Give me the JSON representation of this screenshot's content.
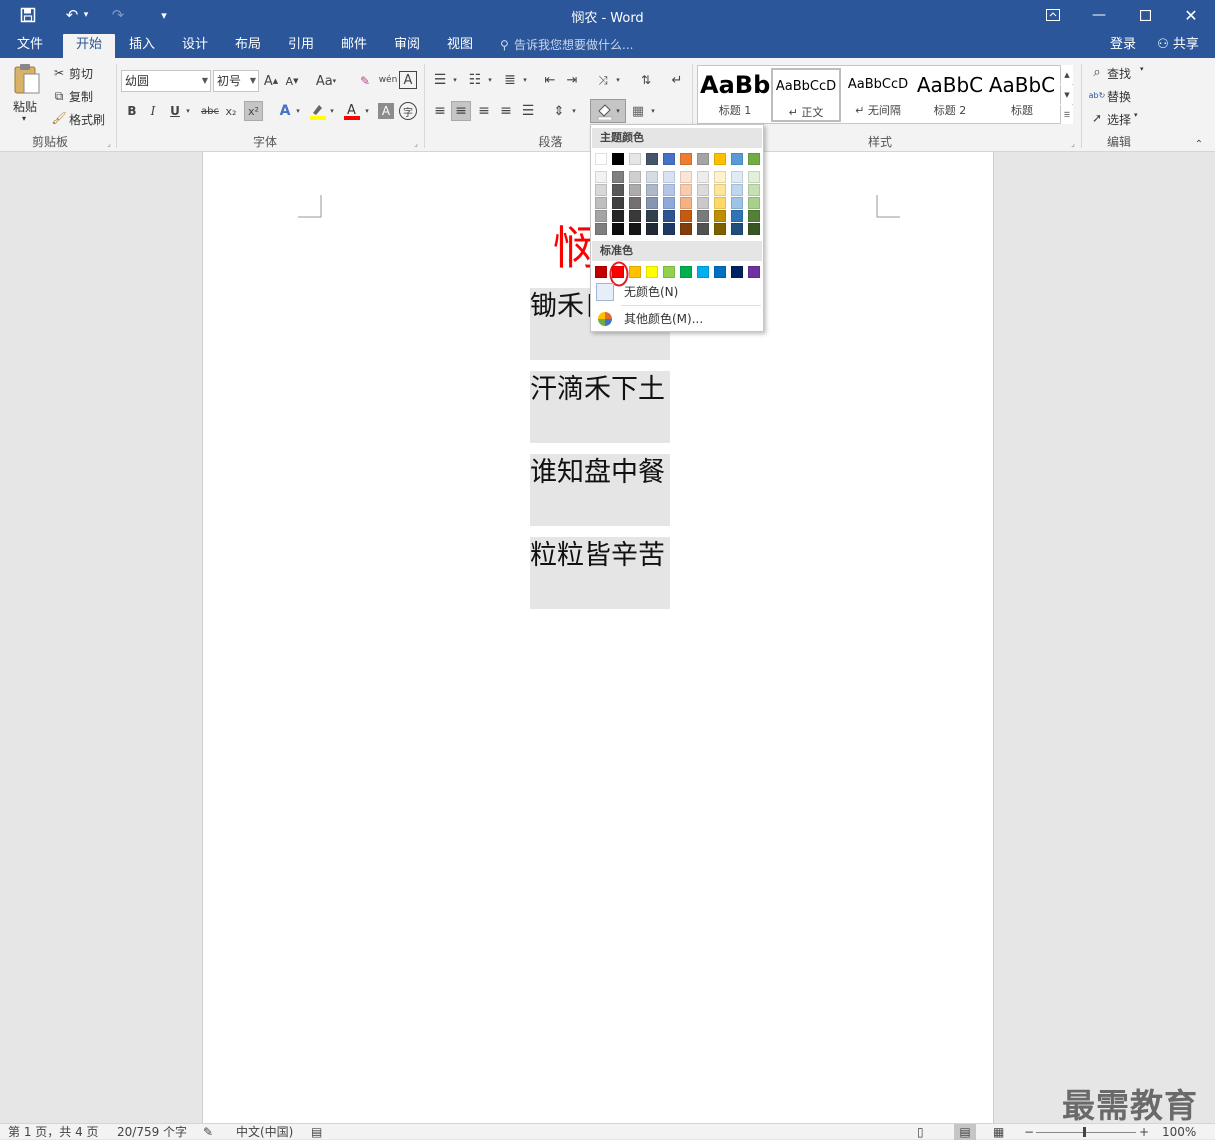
{
  "window": {
    "title": "悯农 - Word"
  },
  "quick_access": {
    "save": "save",
    "undo": "undo",
    "redo": "redo",
    "customize": "customize"
  },
  "window_controls": [
    "restore-ribbon",
    "minimize",
    "maximize",
    "close"
  ],
  "tabs": [
    {
      "label": "文件",
      "active": false
    },
    {
      "label": "开始",
      "active": true
    },
    {
      "label": "插入",
      "active": false
    },
    {
      "label": "设计",
      "active": false
    },
    {
      "label": "布局",
      "active": false
    },
    {
      "label": "引用",
      "active": false
    },
    {
      "label": "邮件",
      "active": false
    },
    {
      "label": "审阅",
      "active": false
    },
    {
      "label": "视图",
      "active": false
    }
  ],
  "tellme": {
    "placeholder": "告诉我您想要做什么..."
  },
  "account": {
    "login": "登录",
    "share": "共享"
  },
  "ribbon": {
    "clipboard": {
      "paste": "粘贴",
      "cut": "剪切",
      "copy": "复制",
      "format_painter": "格式刷",
      "label": "剪贴板"
    },
    "font": {
      "name": "幼圆",
      "size": "初号",
      "label": "字体",
      "bold": "B",
      "italic": "I",
      "underline": "U",
      "strike": "abc",
      "subscript": "x₂",
      "superscript": "x²",
      "case": "Aa",
      "grow": "A",
      "shrink": "A",
      "phonetic": "wén",
      "border_char": "A",
      "char_shading": "A",
      "enclose": "字"
    },
    "paragraph": {
      "label": "段落"
    },
    "styles": {
      "label": "样式",
      "items": [
        {
          "preview": "AaBb",
          "name": "标题 1",
          "selected": false
        },
        {
          "preview": "AaBbCcD",
          "name": "↵ 正文",
          "selected": true
        },
        {
          "preview": "AaBbCcD",
          "name": "↵ 无间隔",
          "selected": false
        },
        {
          "preview": "AaBbC",
          "name": "标题 2",
          "selected": false
        },
        {
          "preview": "AaBbC",
          "name": "标题",
          "selected": false
        }
      ]
    },
    "editing": {
      "label": "编辑",
      "find": "查找",
      "replace": "替换",
      "select": "选择"
    }
  },
  "document": {
    "heading": "悯",
    "lines": [
      "锄禾日",
      "汗滴禾下土",
      "谁知盘中餐",
      "粒粒皆辛苦"
    ]
  },
  "shading_dropdown": {
    "theme_header": "主题颜色",
    "standard_header": "标准色",
    "theme_top": [
      "#ffffff",
      "#000000",
      "#e7e6e6",
      "#44546a",
      "#4472c4",
      "#ed7d31",
      "#a5a5a5",
      "#ffc000",
      "#5b9bd5",
      "#70ad47"
    ],
    "theme_shades": [
      [
        "#f2f2f2",
        "#808080",
        "#d0cece",
        "#d6dce4",
        "#d9e2f3",
        "#fbe5d5",
        "#ededed",
        "#fff2cc",
        "#deebf6",
        "#e2efd9"
      ],
      [
        "#d8d8d8",
        "#595959",
        "#aeabab",
        "#adb9ca",
        "#b4c6e7",
        "#f7cbac",
        "#dbdbdb",
        "#ffe599",
        "#bdd7ee",
        "#c5e0b3"
      ],
      [
        "#bfbfbf",
        "#404040",
        "#757070",
        "#8496b0",
        "#8eaadb",
        "#f4b183",
        "#c9c9c9",
        "#ffd965",
        "#9dc3e6",
        "#a8d08d"
      ],
      [
        "#a5a5a5",
        "#262626",
        "#3a3838",
        "#323f4f",
        "#2f5496",
        "#c55a11",
        "#7b7b7b",
        "#bf8f00",
        "#2e75b5",
        "#538135"
      ],
      [
        "#7f7f7f",
        "#0d0d0d",
        "#161616",
        "#222a35",
        "#1f3864",
        "#833c0b",
        "#525252",
        "#7f6000",
        "#1e4e79",
        "#375623"
      ]
    ],
    "standard": [
      "#c00000",
      "#ff0000",
      "#ffc000",
      "#ffff00",
      "#92d050",
      "#00b050",
      "#00b0f0",
      "#0070c0",
      "#002060",
      "#7030a0"
    ],
    "no_color": "无颜色(N)",
    "more_colors": "其他颜色(M)..."
  },
  "status": {
    "page": "第 1 页，共 4 页",
    "words": "20/759 个字",
    "language": "中文(中国)",
    "zoom": "100%"
  },
  "watermark": "最需教育"
}
